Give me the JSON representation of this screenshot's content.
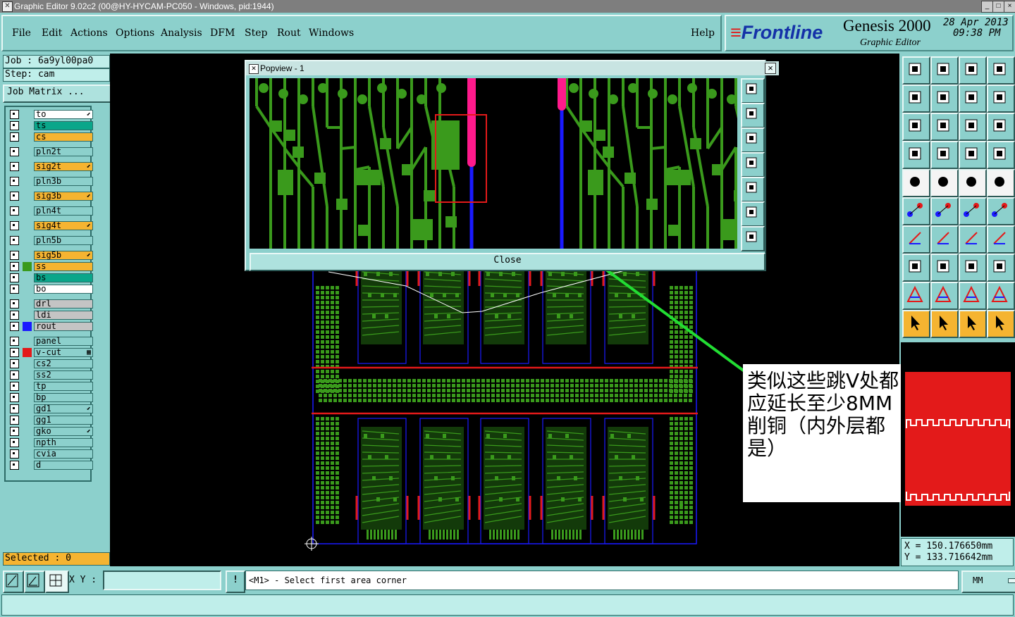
{
  "window": {
    "title": "Graphic Editor 9.02c2 (00@HY-HYCAM-PC050 - Windows, pid:1944)",
    "btn_min": "_",
    "btn_max": "□",
    "btn_close": "×"
  },
  "menu": {
    "items": [
      "File",
      "Edit",
      "Actions",
      "Options",
      "Analysis",
      "DFM",
      "Step",
      "Rout",
      "Windows"
    ],
    "help": "Help"
  },
  "brand": {
    "logo": "Frontline",
    "product": "Genesis 2000",
    "subtitle": "Graphic Editor",
    "date": "28 Apr 2013",
    "time": "09:38 PM"
  },
  "job": {
    "job_line": "Job : 6a9yl00pa0",
    "step_line": "Step: cam",
    "matrix_button": "Job Matrix ..."
  },
  "layers": [
    {
      "name": "to",
      "color": "#ffffff",
      "swatch": "",
      "marker": "⬋"
    },
    {
      "name": "ts",
      "color": "#0aa68a",
      "swatch": "",
      "marker": ""
    },
    {
      "name": "cs",
      "color": "#f5b431",
      "swatch": "",
      "marker": ""
    },
    {
      "name": "pln2t",
      "color": "#8cd0cc",
      "swatch": "",
      "marker": ""
    },
    {
      "name": "sig2t",
      "color": "#f5b431",
      "swatch": "",
      "marker": "⬋"
    },
    {
      "name": "pln3b",
      "color": "#8cd0cc",
      "swatch": "",
      "marker": ""
    },
    {
      "name": "sig3b",
      "color": "#f5b431",
      "swatch": "",
      "marker": "⬋"
    },
    {
      "name": "pln4t",
      "color": "#8cd0cc",
      "swatch": "",
      "marker": ""
    },
    {
      "name": "sig4t",
      "color": "#f5b431",
      "swatch": "",
      "marker": "⬋"
    },
    {
      "name": "pln5b",
      "color": "#8cd0cc",
      "swatch": "",
      "marker": ""
    },
    {
      "name": "sig5b",
      "color": "#f5b431",
      "swatch": "",
      "marker": "⬋"
    },
    {
      "name": "ss",
      "color": "#f5b431",
      "swatch": "#3a9a1c",
      "marker": ""
    },
    {
      "name": "bs",
      "color": "#0aa68a",
      "swatch": "",
      "marker": ""
    },
    {
      "name": "bo",
      "color": "#ffffff",
      "swatch": "",
      "marker": ""
    },
    {
      "name": "drl",
      "color": "#c4c4c4",
      "swatch": "",
      "marker": ""
    },
    {
      "name": "ldi",
      "color": "#c4c4c4",
      "swatch": "",
      "marker": ""
    },
    {
      "name": "rout",
      "color": "#c4c4c4",
      "swatch": "#1a1aff",
      "marker": ""
    },
    {
      "name": "panel",
      "color": "#8cd0cc",
      "swatch": "",
      "marker": ""
    },
    {
      "name": "v-cut",
      "color": "#8cd0cc",
      "swatch": "#e31a1a",
      "marker": "▦"
    },
    {
      "name": "cs2",
      "color": "#8cd0cc",
      "swatch": "",
      "marker": ""
    },
    {
      "name": "ss2",
      "color": "#8cd0cc",
      "swatch": "",
      "marker": ""
    },
    {
      "name": "tp",
      "color": "#8cd0cc",
      "swatch": "",
      "marker": ""
    },
    {
      "name": "bp",
      "color": "#8cd0cc",
      "swatch": "",
      "marker": ""
    },
    {
      "name": "gd1",
      "color": "#8cd0cc",
      "swatch": "",
      "marker": "⬋"
    },
    {
      "name": "gg1",
      "color": "#8cd0cc",
      "swatch": "",
      "marker": ""
    },
    {
      "name": "gko",
      "color": "#8cd0cc",
      "swatch": "",
      "marker": "⬋"
    },
    {
      "name": "npth",
      "color": "#8cd0cc",
      "swatch": "",
      "marker": ""
    },
    {
      "name": "cvia",
      "color": "#8cd0cc",
      "swatch": "",
      "marker": ""
    },
    {
      "name": "d",
      "color": "#8cd0cc",
      "swatch": "",
      "marker": ""
    }
  ],
  "selected": "Selected : 0",
  "popview": {
    "title": "Popview - 1",
    "close_label": "Close",
    "close_x": "×"
  },
  "annotation": {
    "text": "类似这些跳V处都应延长至少8MM削铜（内外层都是）"
  },
  "coords": {
    "x_line": "X  = 150.176650mm",
    "y_line": "Y  = 133.716642mm"
  },
  "status": {
    "xy_label": "X Y :",
    "xy_value": "",
    "info_icon": "!",
    "message": "<M1> - Select first area corner",
    "unit": "MM"
  },
  "colors": {
    "ui_teal": "#8cd0cc",
    "copper_green": "#3a9a1c",
    "vcut_red": "#e31a1a",
    "rout_blue": "#1a1aff",
    "highlight_magenta": "#ff1a8c",
    "annotation_line": "#22dd33"
  }
}
